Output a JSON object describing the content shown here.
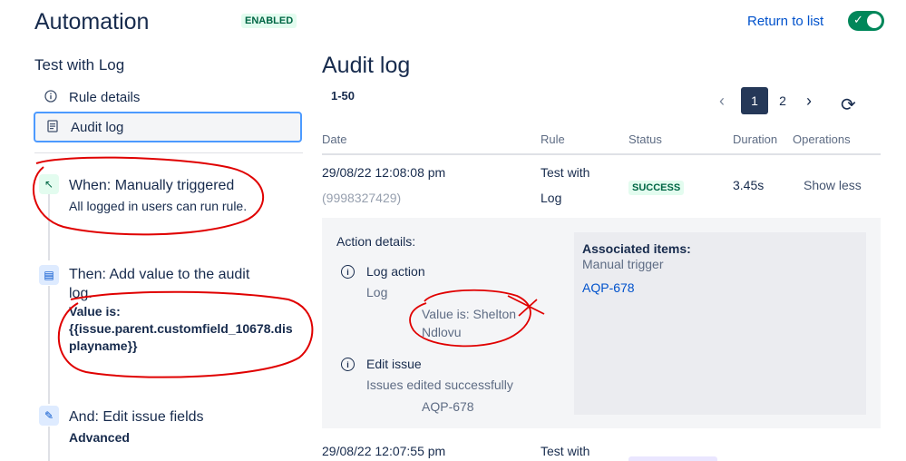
{
  "header": {
    "title": "Automation",
    "status_badge": "ENABLED",
    "return_link": "Return to list",
    "toggle_check": "✓"
  },
  "sidebar": {
    "rule_name": "Test with Log",
    "nav": [
      {
        "label": "Rule details",
        "icon": "info-icon"
      },
      {
        "label": "Audit log",
        "icon": "document-icon"
      }
    ],
    "steps": [
      {
        "title": "When: Manually triggered",
        "subtitle": "All logged in users can run rule.",
        "icon": "cursor-click-icon",
        "icon_glyph": "↖",
        "color": "#e3fcef"
      },
      {
        "title": "Then: Add value to the audit",
        "title_line2": "log.",
        "detail_label": "Value is:",
        "detail_line1": "{{issue.parent.customfield_10678.dis",
        "detail_line2": "playname}}",
        "icon": "document-icon",
        "icon_glyph": "▤",
        "color": "#deebff"
      },
      {
        "title": "And: Edit issue fields",
        "subtitle": "Advanced",
        "icon": "pencil-icon",
        "icon_glyph": "✎",
        "color": "#deebff"
      }
    ]
  },
  "main": {
    "title": "Audit log",
    "range": "1-50",
    "pagination": {
      "prev": "‹",
      "pages": [
        "1",
        "2"
      ],
      "current": "1",
      "next": "›",
      "refresh": "⟳"
    },
    "columns": [
      "Date",
      "Rule",
      "Status",
      "Duration",
      "Operations"
    ],
    "rows": [
      {
        "date": "29/08/22 12:08:08 pm",
        "id": "(9998327429)",
        "rule_line1": "Test with",
        "rule_line2": "Log",
        "status": "SUCCESS",
        "duration": "3.45s",
        "operation": "Show less"
      },
      {
        "date": "29/08/22 12:07:55 pm",
        "rule_line1": "Test with"
      }
    ],
    "details": {
      "heading": "Action details:",
      "actions": [
        {
          "title": "Log action",
          "line1": "Log",
          "value_line1": "Value is: Shelton",
          "value_line2": "Ndlovu"
        },
        {
          "title": "Edit issue",
          "line1": "Issues edited successfully",
          "value_line1": "AQP-678"
        }
      ],
      "assoc_heading": "Associated items:",
      "assoc_line1": "Manual trigger",
      "assoc_link": "AQP-678"
    }
  },
  "colors": {
    "accent": "#0052cc",
    "success": "#006644",
    "annotation": "#e00000"
  }
}
